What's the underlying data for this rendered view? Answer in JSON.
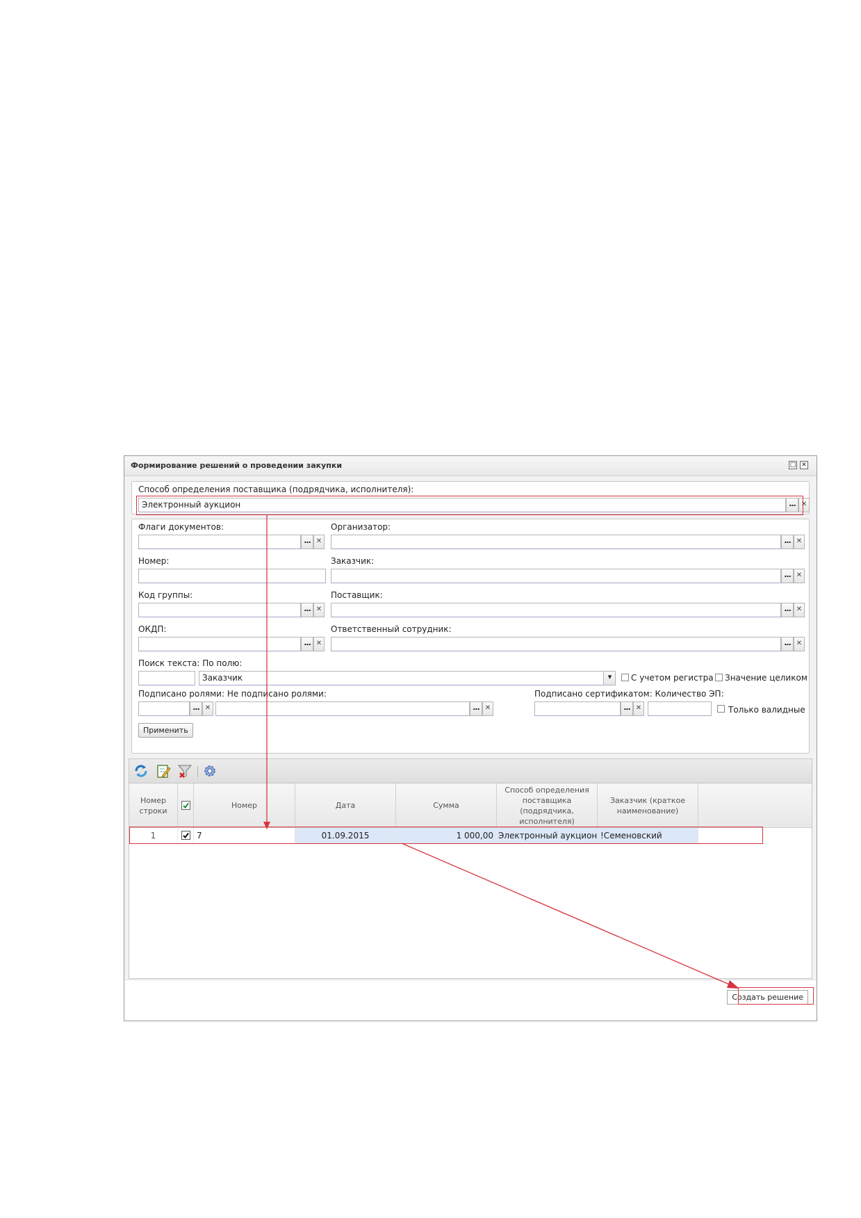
{
  "window": {
    "title": "Формирование решений о проведении закупки",
    "restore_glyph": "□",
    "close_glyph": "✕"
  },
  "method": {
    "label": "Способ определения поставщика (подрядчика, исполнителя):",
    "value": "Электронный аукцион"
  },
  "filters": {
    "flags_label": "Флаги документов:",
    "flags_value": "",
    "organizer_label": "Организатор:",
    "organizer_value": "",
    "number_label": "Номер:",
    "number_value": "",
    "customer_label": "Заказчик:",
    "customer_value": "",
    "group_code_label": "Код группы:",
    "group_code_value": "",
    "supplier_label": "Поставщик:",
    "supplier_value": "",
    "okdp_label": "ОКДП:",
    "okdp_value": "",
    "responsible_label": "Ответственный сотрудник:",
    "responsible_value": "",
    "text_search_label": "Поиск текста: По полю:",
    "text_search_value": "",
    "field_select_value": "Заказчик",
    "case_sensitive_label": "С учетом регистра",
    "whole_value_label": "Значение целиком",
    "signed_roles_label": "Подписано ролями: Не подписано ролями:",
    "signed_cert_label": "Подписано сертификатом: Количество ЭП:",
    "only_valid_label": "Только валидные",
    "apply_button": "Применить",
    "pick_glyph": "...",
    "clear_glyph": "✕",
    "dropdown_glyph": "▾"
  },
  "toolbar": {
    "icons": [
      "refresh-icon",
      "edit-icon",
      "clear-filter-icon",
      "settings-icon"
    ]
  },
  "grid": {
    "columns": [
      "Номер строки",
      "",
      "Номер",
      "Дата",
      "Сумма",
      "Способ определения поставщика (подрядчика, исполнителя)",
      "Заказчик (краткое наименование)"
    ],
    "rows": [
      {
        "row_number": "1",
        "checked": true,
        "number": "7",
        "date": "01.09.2015",
        "sum": "1 000,00",
        "method": "Электронный аукцион",
        "customer": "!Семеновский"
      }
    ]
  },
  "footer": {
    "create_button": "Создать решение"
  },
  "colors": {
    "highlight": "#d9333f",
    "row_selected": "#dce7f7",
    "header_bg": "#e8e8e8"
  }
}
